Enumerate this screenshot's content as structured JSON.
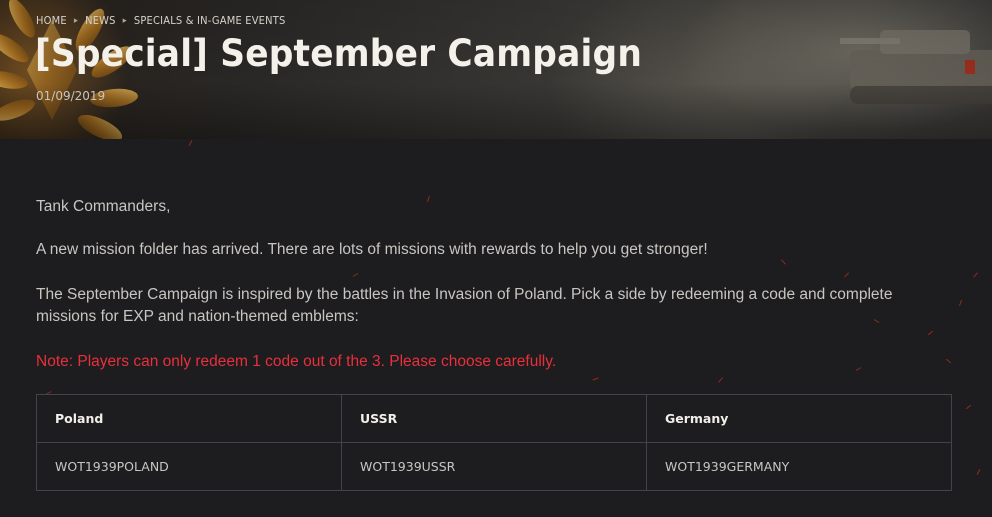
{
  "breadcrumb": {
    "items": [
      "HOME",
      "NEWS",
      "SPECIALS & IN-GAME EVENTS"
    ],
    "separator": ">"
  },
  "page": {
    "title": "[Special] September Campaign",
    "date": "01/09/2019"
  },
  "article": {
    "greeting": "Tank Commanders,",
    "intro": "A new mission folder has arrived. There are lots of missions with rewards to help you get stronger!",
    "description": "The September Campaign is inspired by the battles in the Invasion of Poland. Pick a side by redeeming a code and complete missions for EXP and nation-themed emblems:",
    "note": "Note: Players can only redeem 1 code out of the 3. Please choose carefully."
  },
  "codes_table": {
    "headers": [
      "Poland",
      "USSR",
      "Germany"
    ],
    "rows": [
      [
        "WOT1939POLAND",
        "WOT1939USSR",
        "WOT1939GERMANY"
      ]
    ]
  },
  "colors": {
    "background": "#1d1c1e",
    "note_red": "#e8303d",
    "table_border": "#45434a"
  },
  "icons": {
    "breadcrumb_separator": "chevron-right-icon",
    "banner_emblem": "laurel-wreath-icon"
  }
}
